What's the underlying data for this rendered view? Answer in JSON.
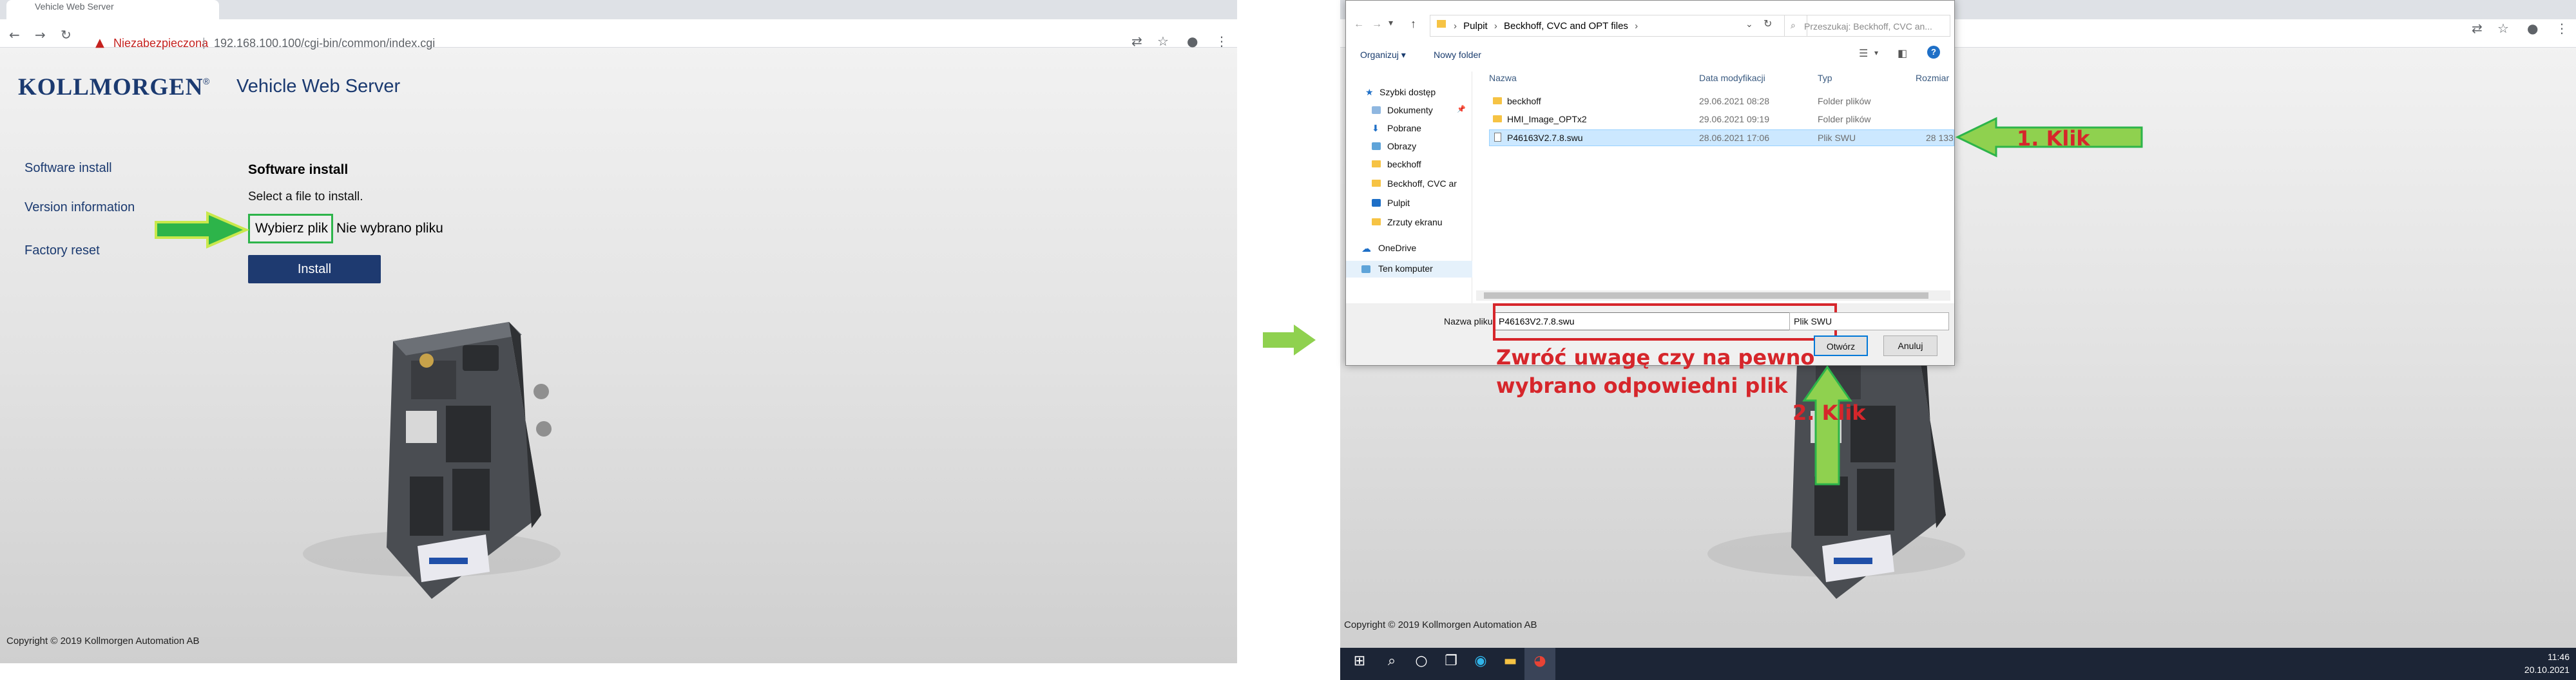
{
  "left_window": {
    "tab_title": "Vehicle Web Server",
    "security_warning": "Niezabezpieczona",
    "url": "192.168.100.100/cgi-bin/common/index.cgi",
    "brand": "KOLLMORGEN",
    "brand_mark": "®",
    "app_title": "Vehicle Web Server",
    "sidebar": [
      {
        "label": "Software install"
      },
      {
        "label": "Version information"
      },
      {
        "label": "Factory reset"
      }
    ],
    "section_title": "Software install",
    "hint": "Select a file to install.",
    "file_button": "Wybierz plik",
    "no_file_text": "Nie wybrano pliku",
    "install_button": "Install",
    "copyright": "Copyright © 2019 Kollmorgen Automation AB"
  },
  "dialog": {
    "breadcrumb": [
      "Pulpit",
      "Beckhoff, CVC and OPT files"
    ],
    "search_placeholder": "Przeszukaj: Beckhoff, CVC an...",
    "toolbar": {
      "organize": "Organizuj ▾",
      "new_folder": "Nowy folder"
    },
    "nav_items": [
      {
        "label": "Szybki dostęp",
        "icon": "star-icon"
      },
      {
        "label": "Dokumenty",
        "icon": "documents-icon"
      },
      {
        "label": "Pobrane",
        "icon": "download-icon"
      },
      {
        "label": "Obrazy",
        "icon": "pictures-icon"
      },
      {
        "label": "beckhoff",
        "icon": "folder-icon"
      },
      {
        "label": "Beckhoff, CVC ar",
        "icon": "folder-icon"
      },
      {
        "label": "Pulpit",
        "icon": "desktop-icon"
      },
      {
        "label": "Zrzuty ekranu",
        "icon": "folder-icon"
      },
      {
        "label": "OneDrive",
        "icon": "cloud-icon"
      },
      {
        "label": "Ten komputer",
        "icon": "computer-icon"
      }
    ],
    "columns": [
      "Nazwa",
      "Data modyfikacji",
      "Typ",
      "Rozmiar"
    ],
    "files": [
      {
        "name": "beckhoff",
        "date": "29.06.2021 08:28",
        "type": "Folder plików",
        "size": ""
      },
      {
        "name": "HMI_Image_OPTx2",
        "date": "29.06.2021 09:19",
        "type": "Folder plików",
        "size": ""
      },
      {
        "name": "P46163V2.7.8.swu",
        "date": "28.06.2021 17:06",
        "type": "Plik SWU",
        "size": "28 133"
      }
    ],
    "filename_label": "Nazwa pliku:",
    "filename_value": "P46163V2.7.8.swu",
    "filetype_value": "Plik SWU",
    "open_button": "Otwórz",
    "cancel_button": "Anuluj"
  },
  "right_window": {
    "copyright": "Copyright © 2019 Kollmorgen Automation AB"
  },
  "annotations": {
    "click1": "1. Klik",
    "click2": "2. Klik",
    "note_line1": "Zwróć uwagę czy na pewno",
    "note_line2": "wybrano odpowiedni plik"
  },
  "taskbar": {
    "time": "11:46",
    "date": "20.10.2021"
  },
  "colors": {
    "accent_green": "#2db44a",
    "arrow_fill": "#8fd14f",
    "annotation_red": "#d6262b",
    "brand_blue": "#1b3a70"
  }
}
